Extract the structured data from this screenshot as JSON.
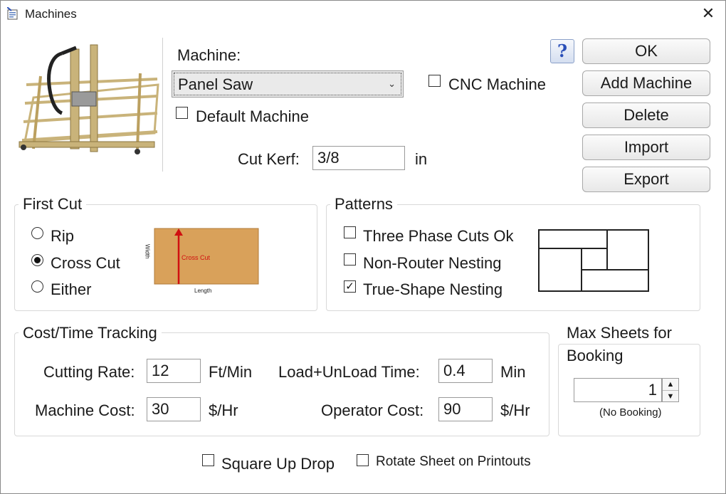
{
  "window": {
    "title": "Machines"
  },
  "icons": {
    "app": "window-app-icon",
    "close": "close-icon",
    "help": "help-icon"
  },
  "machine": {
    "label": "Machine:",
    "selected": "Panel Saw",
    "cnc_label": "CNC Machine",
    "cnc_checked": false,
    "default_label": "Default Machine",
    "default_checked": false,
    "kerf_label": "Cut Kerf:",
    "kerf_value": "3/8",
    "kerf_unit": "in"
  },
  "buttons": {
    "help": "?",
    "ok": "OK",
    "add": "Add Machine",
    "delete": "Delete",
    "import": "Import",
    "export": "Export"
  },
  "first_cut": {
    "title": "First Cut",
    "options": [
      "Rip",
      "Cross Cut",
      "Either"
    ],
    "selected": "Cross Cut",
    "diagram": {
      "width_label": "Width",
      "length_label": "Length",
      "cut_label": "Cross Cut"
    }
  },
  "patterns": {
    "title": "Patterns",
    "options": [
      {
        "label": "Three Phase Cuts Ok",
        "checked": false
      },
      {
        "label": "Non-Router Nesting",
        "checked": false
      },
      {
        "label": "True-Shape Nesting",
        "checked": true
      }
    ]
  },
  "cost": {
    "title": "Cost/Time Tracking",
    "cutting_rate_label": "Cutting Rate:",
    "cutting_rate": "12",
    "cutting_rate_unit": "Ft/Min",
    "load_label": "Load+UnLoad Time:",
    "load": "0.4",
    "load_unit": "Min",
    "machine_cost_label": "Machine Cost:",
    "machine_cost": "30",
    "machine_cost_unit": "$/Hr",
    "operator_cost_label": "Operator Cost:",
    "operator_cost": "90",
    "operator_cost_unit": "$/Hr"
  },
  "max_sheets": {
    "title_line1": "Max Sheets for",
    "title_line2": "Booking",
    "value": "1",
    "note": "(No Booking)"
  },
  "bottom": {
    "square_up_label": "Square Up Drop",
    "square_up_checked": false,
    "rotate_label": "Rotate Sheet on Printouts",
    "rotate_checked": false
  },
  "colors": {
    "wood": "#d9a15a",
    "arrow": "#d01010",
    "frame": "#c9b37a"
  }
}
